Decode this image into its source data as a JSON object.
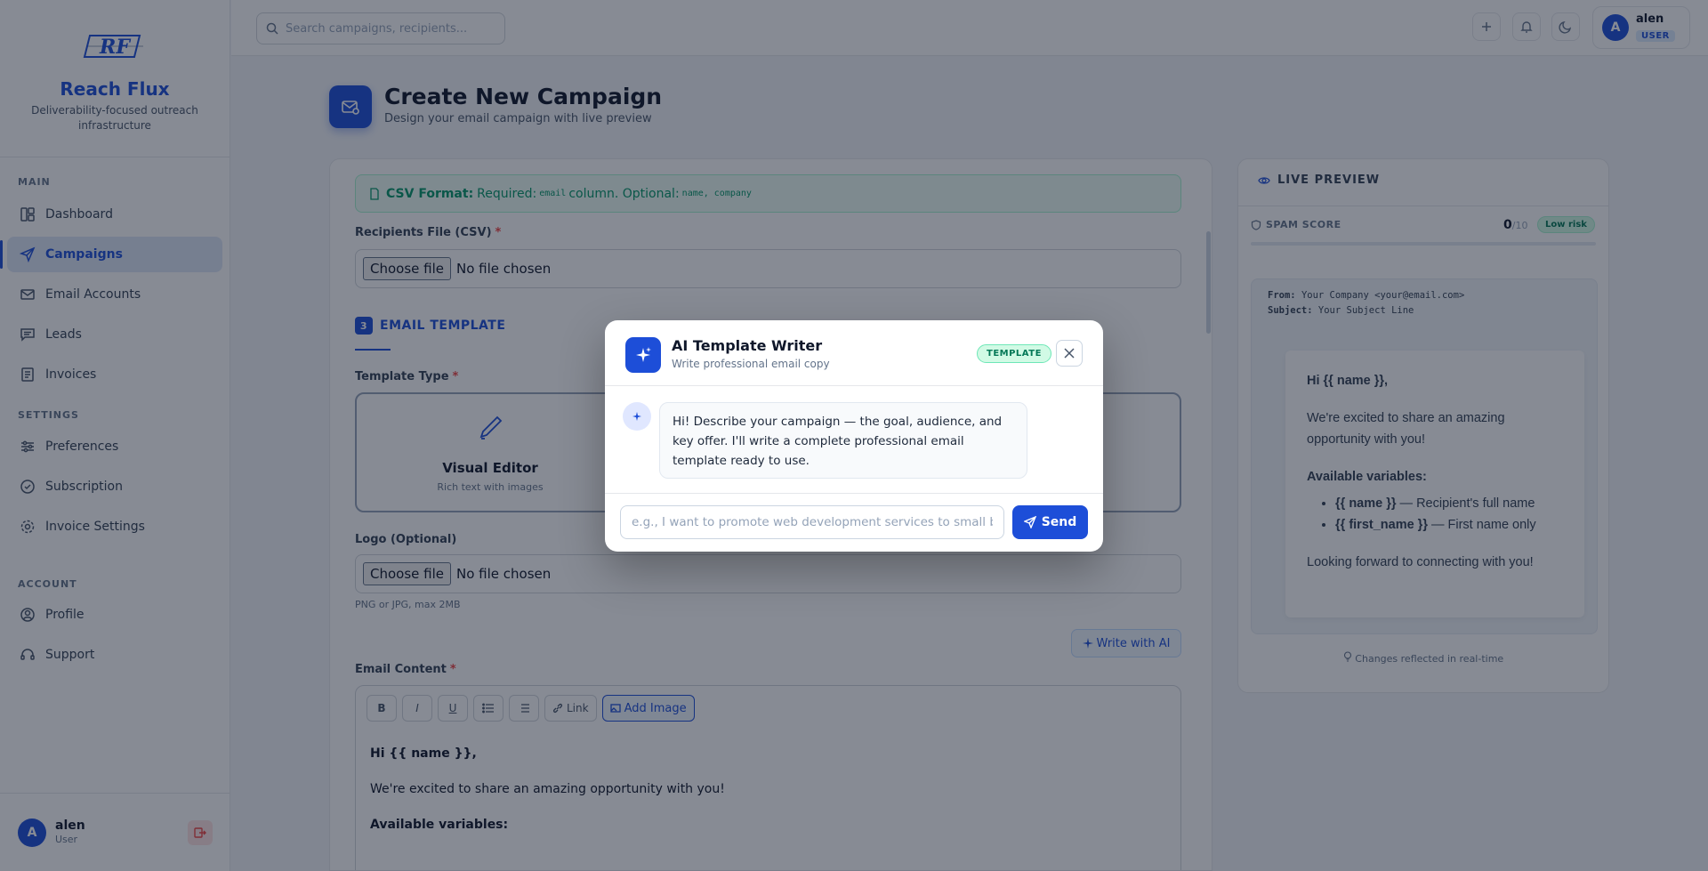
{
  "brand": {
    "name": "Reach Flux",
    "tagline": "Deliverability-focused outreach infrastructure"
  },
  "sidebar": {
    "sections": [
      {
        "label": "MAIN"
      },
      {
        "label": "SETTINGS"
      },
      {
        "label": "ACCOUNT"
      }
    ],
    "items": [
      {
        "label": "Dashboard",
        "icon": "dashboard-icon"
      },
      {
        "label": "Campaigns",
        "icon": "send-icon",
        "active": true
      },
      {
        "label": "Email Accounts",
        "icon": "mail-icon"
      },
      {
        "label": "Leads",
        "icon": "chat-icon"
      },
      {
        "label": "Invoices",
        "icon": "invoice-icon"
      },
      {
        "label": "Preferences",
        "icon": "sliders-icon"
      },
      {
        "label": "Subscription",
        "icon": "check-circle-icon"
      },
      {
        "label": "Invoice Settings",
        "icon": "gear-icon"
      },
      {
        "label": "Profile",
        "icon": "user-icon"
      },
      {
        "label": "Support",
        "icon": "headset-icon"
      }
    ],
    "user": {
      "initial": "A",
      "name": "alen",
      "role": "User"
    }
  },
  "topbar": {
    "search_placeholder": "Search campaigns, recipients...",
    "user": {
      "initial": "A",
      "name": "alen",
      "role": "USER"
    }
  },
  "page": {
    "title": "Create New Campaign",
    "subtitle": "Design your email campaign with live preview"
  },
  "form": {
    "csv_note": {
      "label": "CSV Format:",
      "text_required": "Required:",
      "required_field": "email",
      "text_column": "column. Optional:",
      "optional_fields": [
        "name,",
        "company"
      ]
    },
    "recipients_label": "Recipients File (CSV)",
    "file_button": "Choose file",
    "file_status": "No file chosen",
    "section": {
      "number": "3",
      "title": "EMAIL TEMPLATE"
    },
    "template_type_label": "Template Type",
    "visual_editor": {
      "title": "Visual Editor",
      "subtitle": "Rich text with images"
    },
    "logo_label": "Logo (Optional)",
    "logo_hint": "PNG or JPG, max 2MB",
    "write_ai": "Write with AI",
    "email_content_label": "Email Content",
    "toolbar": {
      "bold": "B",
      "italic": "I",
      "underline": "U",
      "link": "Link",
      "add_image": "Add Image"
    },
    "editor_lines": [
      "Hi {{ name }},",
      "We're excited to share an amazing opportunity with you!",
      "Available variables:"
    ]
  },
  "preview": {
    "title": "LIVE PREVIEW",
    "spam_label": "SPAM SCORE",
    "spam_score": "0",
    "spam_max": "/10",
    "risk": "Low risk",
    "spam_level": 0,
    "from_label": "From:",
    "from_value": "Your Company <your@email.com>",
    "subject_label": "Subject:",
    "subject_value": "Your Subject Line",
    "greeting": "Hi {{ name }},",
    "intro": "We're excited to share an amazing opportunity with you!",
    "vars_heading": "Available variables:",
    "vars": [
      {
        "name": "{{ name }}",
        "desc": " — Recipient's full name"
      },
      {
        "name": "{{ first_name }}",
        "desc": " — First name only"
      }
    ],
    "closing": "Looking forward to connecting with you!",
    "footer": "Changes reflected in real-time"
  },
  "modal": {
    "title": "AI Template Writer",
    "subtitle": "Write professional email copy",
    "badge": "TEMPLATE",
    "message": "Hi! Describe your campaign — the goal, audience, and key offer. I'll write a complete professional email template ready to use.",
    "input_placeholder": "e.g., I want to promote web development services to small b",
    "send_label": "Send"
  },
  "colors": {
    "accent": "#1d4ed8",
    "success": "#047857",
    "danger": "#ef4444"
  }
}
